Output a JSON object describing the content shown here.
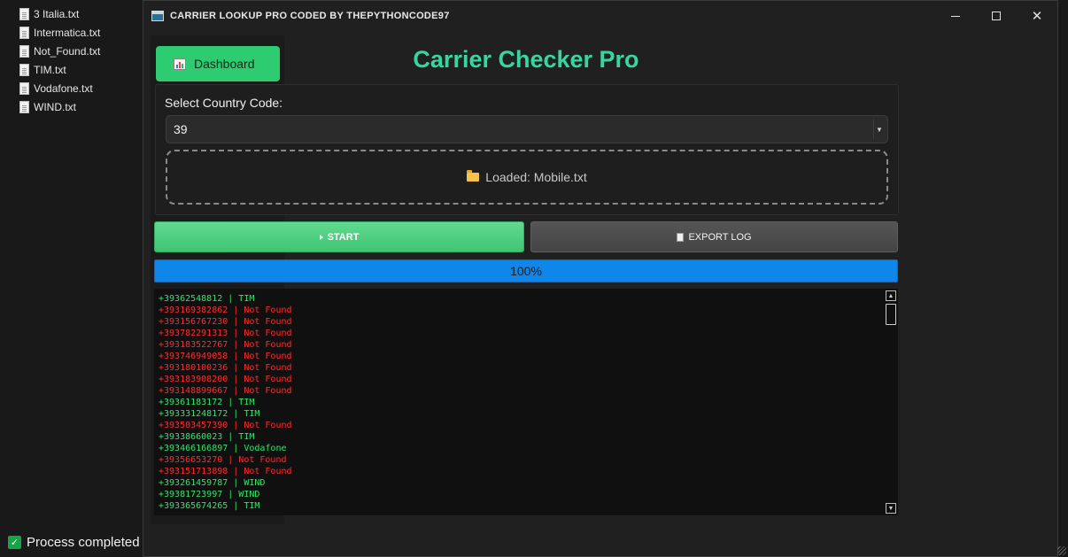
{
  "desktop": {
    "files": [
      {
        "name": "3 Italia.txt"
      },
      {
        "name": "Intermatica.txt"
      },
      {
        "name": "Not_Found.txt"
      },
      {
        "name": "TIM.txt"
      },
      {
        "name": "Vodafone.txt"
      },
      {
        "name": "WIND.txt"
      }
    ]
  },
  "window": {
    "title": "CARRIER LOOKUP PRO CODED BY THEPYTHONCODE97",
    "controls": {
      "minimize": "minimize-icon",
      "maximize": "maximize-icon",
      "close": "close-icon",
      "close_glyph": "✕"
    }
  },
  "sidebar": {
    "dashboard_label": "Dashboard",
    "dashboard_icon": "bar-chart-icon"
  },
  "main": {
    "title": "Carrier Checker Pro",
    "country": {
      "label": "Select Country Code:",
      "selected": "39",
      "arrow_glyph": "▼"
    },
    "file": {
      "loaded_text": "Loaded: Mobile.txt",
      "icon": "folder-icon"
    },
    "start_label": "START",
    "export_label": "EXPORT LOG",
    "progress": {
      "value": 100,
      "label": "100%"
    },
    "log": [
      {
        "text": "+39362548812 | TIM",
        "status": "ok"
      },
      {
        "text": "+393169382862 | Not Found",
        "status": "nf"
      },
      {
        "text": "+393156767230 | Not Found",
        "status": "nf"
      },
      {
        "text": "+393782291313 | Not Found",
        "status": "nf"
      },
      {
        "text": "+393183522767 | Not Found",
        "status": "nf"
      },
      {
        "text": "+393746949058 | Not Found",
        "status": "nf"
      },
      {
        "text": "+393180100236 | Not Found",
        "status": "nf"
      },
      {
        "text": "+393183908200 | Not Found",
        "status": "nf"
      },
      {
        "text": "+393148899667 | Not Found",
        "status": "nf"
      },
      {
        "text": "+39361183172 | TIM",
        "status": "ok"
      },
      {
        "text": "+393331248172 | TIM",
        "status": "ok"
      },
      {
        "text": "+393503457390 | Not Found",
        "status": "nf"
      },
      {
        "text": "+39338660023 | TIM",
        "status": "ok"
      },
      {
        "text": "+393466166897 | Vodafone",
        "status": "ok"
      },
      {
        "text": "+39356653270 | Not Found",
        "status": "nf"
      },
      {
        "text": "+393151713898 | Not Found",
        "status": "nf"
      },
      {
        "text": "+393261459787 | WIND",
        "status": "ok"
      },
      {
        "text": "+39381723997 | WIND",
        "status": "ok"
      },
      {
        "text": "+393365674265 | TIM",
        "status": "ok"
      }
    ],
    "scroll_up_glyph": "▲",
    "scroll_down_glyph": "▼"
  },
  "status": {
    "text": "Process completed",
    "check_glyph": "✓"
  },
  "colors": {
    "accent_green": "#2ecc71",
    "title_teal": "#37d6a0",
    "progress_blue": "#0f86ea",
    "log_ok": "#34e26a",
    "log_not_found": "#ff2a2a"
  }
}
